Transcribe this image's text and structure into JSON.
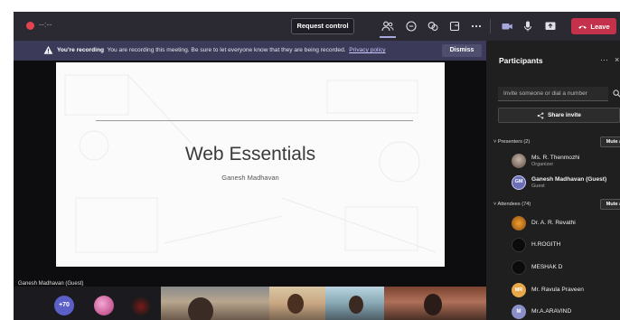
{
  "toolbar": {
    "timer": "--:--",
    "request_control": "Request control",
    "leave": "Leave",
    "icons": [
      "people-icon",
      "chat-icon",
      "reactions-icon",
      "rooms-icon",
      "more-icon",
      "camera-icon",
      "mic-icon",
      "share-icon",
      "phone-icon"
    ]
  },
  "banner": {
    "heading": "You're recording",
    "message": "You are recording this meeting. Be sure to let everyone know that they are being recorded.",
    "link": "Privacy policy",
    "dismiss": "Dismiss"
  },
  "slide": {
    "title": "Web Essentials",
    "subtitle": "Ganesh Madhavan"
  },
  "presenter_tag": "Ganesh Madhavan (Guest)",
  "strip": {
    "more_count": "+70",
    "video_tiles": [
      {
        "name": ""
      },
      {
        "name": ""
      },
      {
        "name": ""
      },
      {
        "name": ""
      }
    ]
  },
  "participants": {
    "title": "Participants",
    "invite_placeholder": "Invite someone or dial a number",
    "share_invite": "Share invite",
    "presenters_label": "Presenters (2)",
    "mute_all": "Mute all",
    "presenters": [
      {
        "name": "Ms. R. Thenmozhi",
        "role": "Organizer",
        "initials": ""
      },
      {
        "name": "Ganesh Madhavan (Guest)",
        "role": "Guest",
        "initials": "GM"
      }
    ],
    "attendees_label": "Attendees (74)",
    "attendees": [
      {
        "name": "Dr. A. R. Revathi",
        "initials": ""
      },
      {
        "name": "H.ROGITH",
        "initials": ""
      },
      {
        "name": "MESHAK D",
        "initials": ""
      },
      {
        "name": "Mr. Ravula Praveen",
        "initials": "MR"
      },
      {
        "name": "Mr.A.ARAVIND",
        "initials": "M"
      }
    ]
  },
  "colors": {
    "toolbar_bg": "#2b2a33",
    "banner_bg": "#3b3a58",
    "leave_red": "#c4314b",
    "accent": "#a6a7dc",
    "pane_bg": "#1f1f1f"
  }
}
